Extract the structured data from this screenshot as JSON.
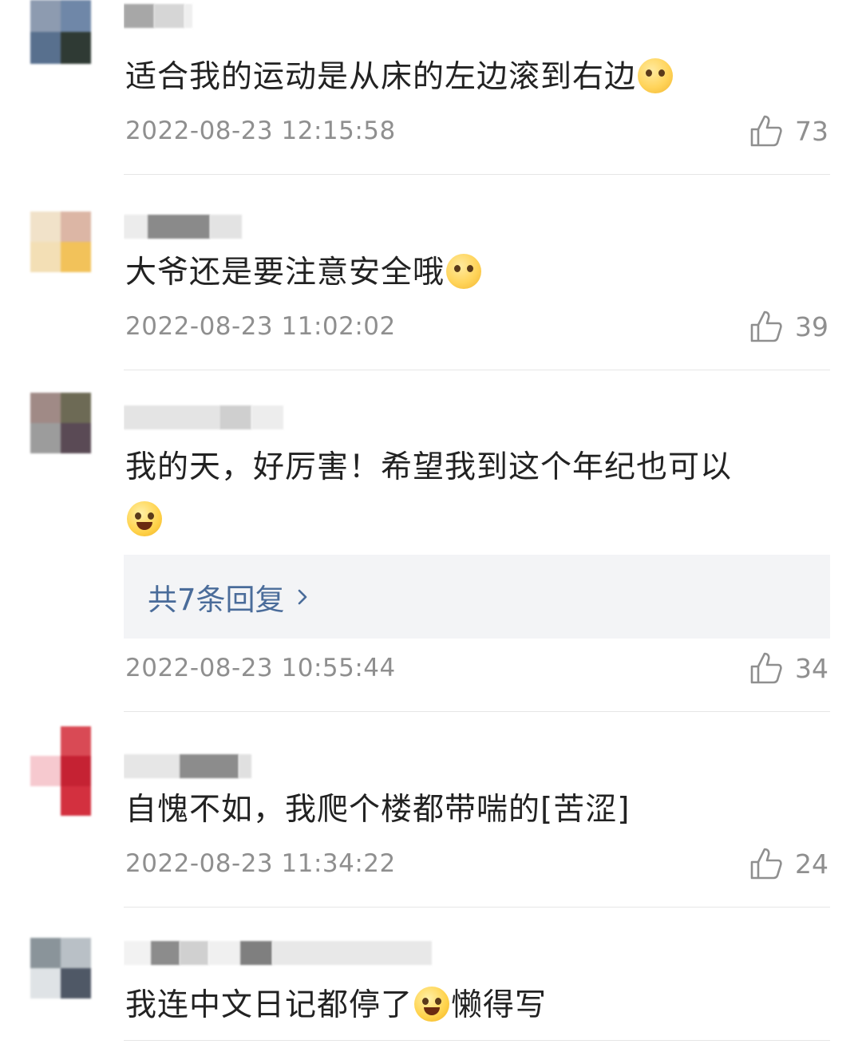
{
  "comments": [
    {
      "text": "适合我的运动是从床的左边滚到右边",
      "emoji": "flushed-face-emoji",
      "time": "2022-08-23 12:15:58",
      "likes": "73"
    },
    {
      "text": "大爷还是要注意安全哦",
      "emoji": "blushing-heart-emoji",
      "time": "2022-08-23 11:02:02",
      "likes": "39"
    },
    {
      "text": "我的天，好厉害！希望我到这个年纪也可以",
      "emoji": "laughing-crying-emoji",
      "reply": "共7条回复",
      "time": "2022-08-23 10:55:44",
      "likes": "34"
    },
    {
      "text": "自愧不如，我爬个楼都带喘的[苦涩]",
      "time": "2022-08-23 11:34:22",
      "likes": "24"
    },
    {
      "text_before": "我连中文日记都停了",
      "emoji": "laughing-crying-emoji",
      "text_after": "懒得写"
    }
  ],
  "colors": {
    "text": "#222222",
    "meta": "#8f8f8f",
    "reply_link": "#4a6c9a",
    "reply_bg": "#f3f4f6",
    "divider": "#e6e6e6"
  }
}
